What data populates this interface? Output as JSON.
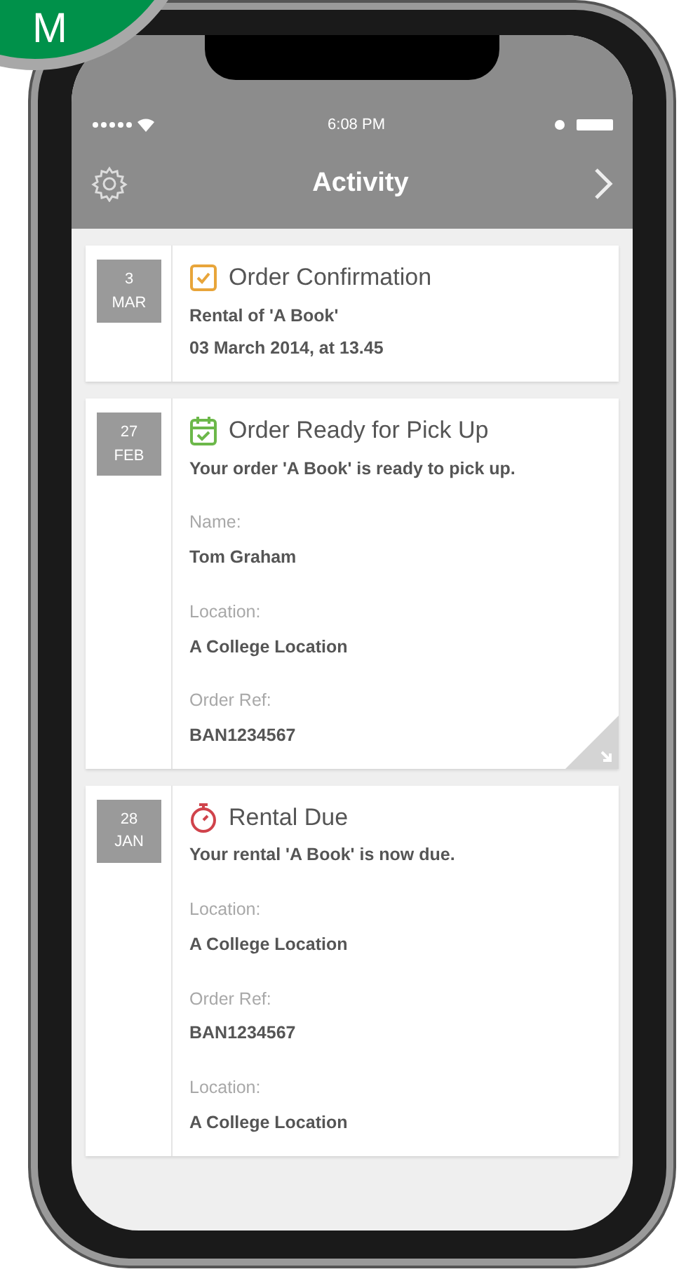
{
  "badge": {
    "text": "M"
  },
  "status_bar": {
    "time": "6:08 PM"
  },
  "nav_bar": {
    "title": "Activity"
  },
  "cards": [
    {
      "day": "3",
      "month": "MAR",
      "kind": "confirmation",
      "color": "#e8a53a",
      "title": "Order Confirmation",
      "lines": [
        "Rental of 'A Book'",
        "03 March 2014, at 13.45"
      ],
      "corner_fold": false
    },
    {
      "day": "27",
      "month": "FEB",
      "kind": "ready",
      "color": "#6cb84a",
      "title": "Order Ready for Pick Up",
      "lines": [
        "Your order 'A Book' is ready to pick up."
      ],
      "fields": [
        {
          "label": "Name:",
          "value": "Tom Graham"
        },
        {
          "label": "Location:",
          "value": "A College Location"
        },
        {
          "label": "Order Ref:",
          "value": "BAN1234567"
        }
      ],
      "corner_fold": true
    },
    {
      "day": "28",
      "month": "JAN",
      "kind": "due",
      "color": "#d0434b",
      "title": "Rental Due",
      "lines": [
        "Your rental 'A Book' is now due."
      ],
      "fields": [
        {
          "label": "Location:",
          "value": "A College Location"
        },
        {
          "label": "Order Ref:",
          "value": "BAN1234567"
        },
        {
          "label": "Location:",
          "value": "A College Location"
        }
      ],
      "corner_fold": false
    }
  ]
}
